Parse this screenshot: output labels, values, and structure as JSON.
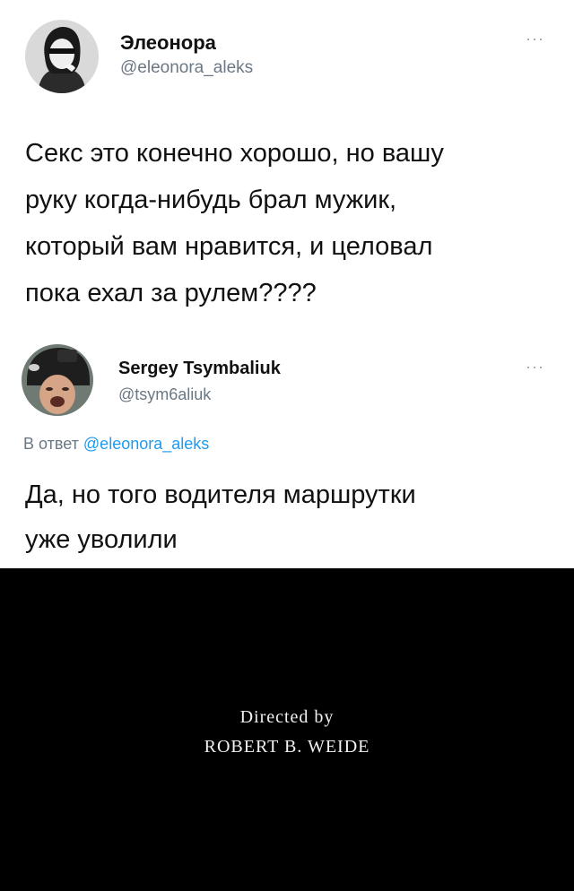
{
  "tweets": [
    {
      "author": {
        "name": "Элеонора",
        "handle": "@eleonora_aleks",
        "avatar_icon": "avatar-woman-sunglasses"
      },
      "more_icon": "more-dots-icon",
      "more_label": "···",
      "text": "Секс это конечно хорошо, но вашу\nруку когда-нибудь брал мужик,\nкоторый вам нравится, и целовал\nпока ехал за рулем????"
    },
    {
      "author": {
        "name": "Sergey Tsymbaliuk",
        "handle": "@tsym6aliuk",
        "avatar_icon": "avatar-person-helmet"
      },
      "more_icon": "more-dots-icon",
      "more_label": "···",
      "reply_context": {
        "prefix": "В ответ",
        "mention": "@eleonora_aleks"
      },
      "text": "Да, но того водителя маршрутки\nуже уволили"
    }
  ],
  "credits": {
    "line1": "Directed by",
    "line2": "ROBERT B. WEIDE",
    "background": "#000000",
    "text_color": "#f2f2f2"
  },
  "colors": {
    "handle_gray": "#6b7884",
    "mention_blue": "#1d9bf0"
  }
}
